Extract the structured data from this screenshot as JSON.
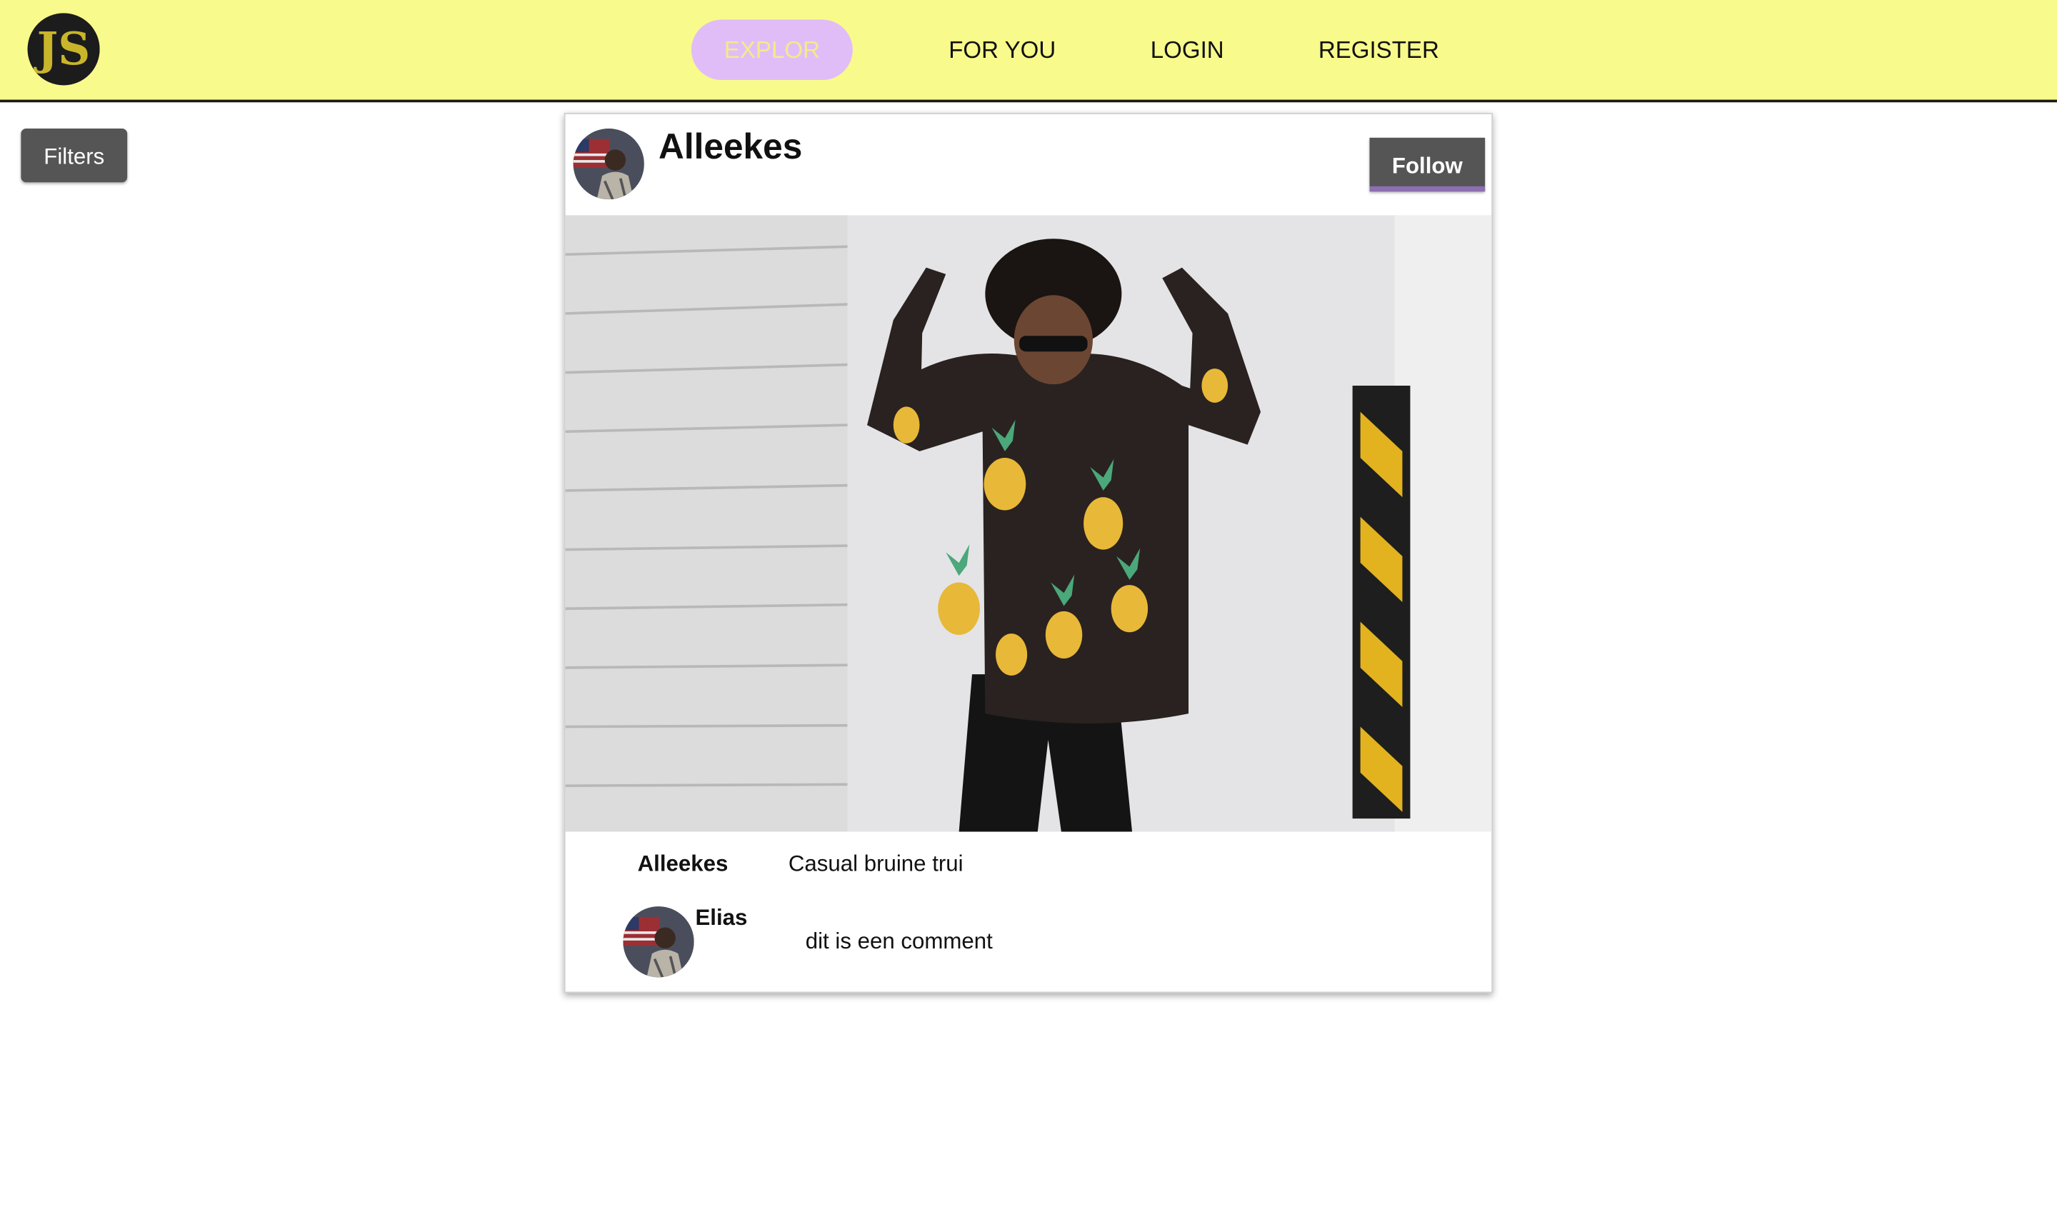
{
  "navbar": {
    "logo_text": "JS",
    "items": [
      {
        "label": "EXPLOR"
      },
      {
        "label": "FOR YOU"
      },
      {
        "label": "LOGIN"
      },
      {
        "label": "REGISTER"
      }
    ]
  },
  "sidebar": {
    "filters_label": "Filters"
  },
  "post": {
    "username": "Alleekes",
    "follow_label": "Follow",
    "caption": {
      "user": "Alleekes",
      "text": "Casual bruine trui"
    },
    "comments": [
      {
        "user": "Elias",
        "text": "dit is een comment"
      }
    ]
  },
  "colors": {
    "navbar_bg": "#f8fa8c",
    "explore_pill": "#e1bdf7",
    "explore_text": "#f5e98a",
    "button_bg": "#555555",
    "follow_underline": "#8b6fb0"
  }
}
